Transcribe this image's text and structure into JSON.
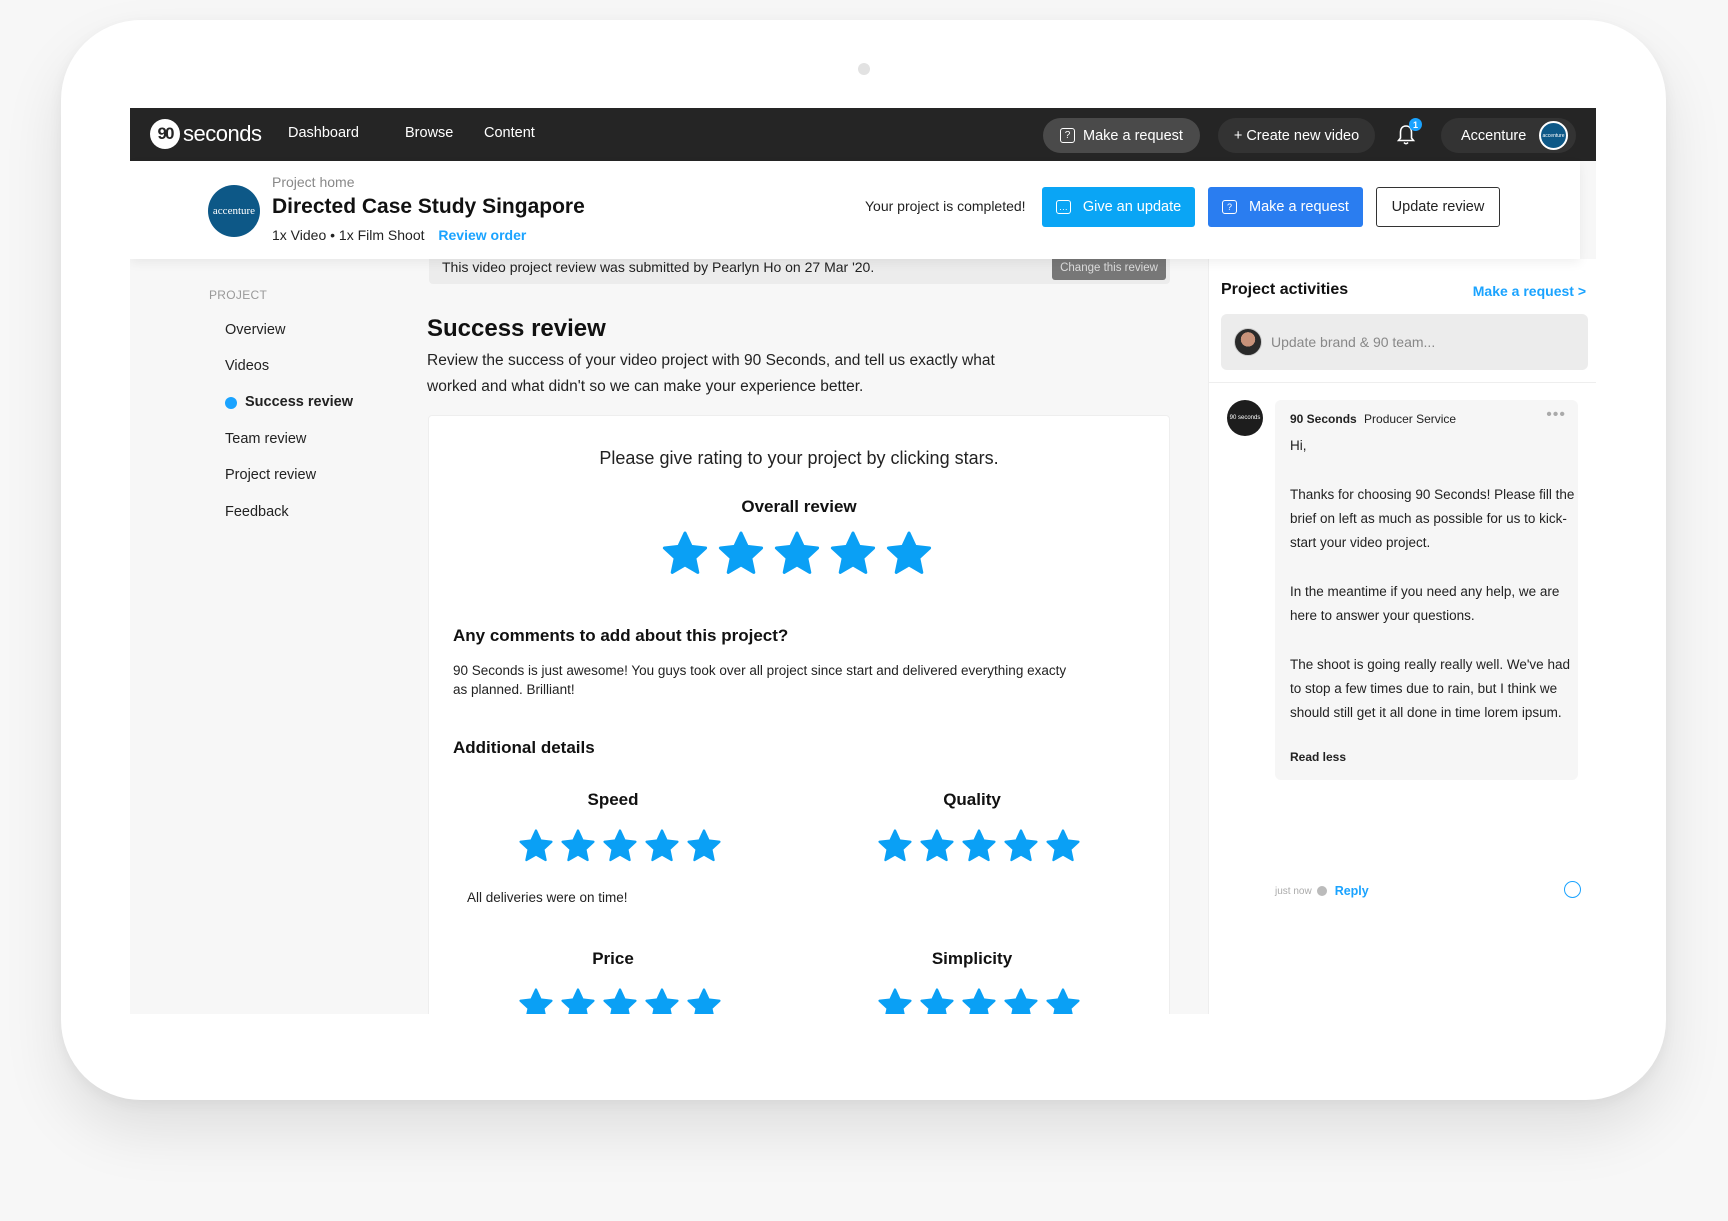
{
  "nav": {
    "logo_mark": "90",
    "logo_text": "seconds",
    "links": [
      "Dashboard",
      "Browse",
      "Content"
    ],
    "make_request": "Make a request",
    "create_video": "+ Create new video",
    "notification_count": "1",
    "account_name": "Accenture",
    "account_avatar_text": "accenture"
  },
  "project": {
    "breadcrumb": "Project home",
    "client_logo_text": "accenture",
    "title": "Directed Case Study Singapore",
    "meta": "1x Video • 1x Film Shoot",
    "review_order": "Review order",
    "status": "Your project is completed!",
    "give_update": "Give an update",
    "make_request": "Make a request",
    "update_review": "Update review"
  },
  "sidebar": {
    "heading": "PROJECT",
    "items": [
      {
        "label": "Overview",
        "active": false
      },
      {
        "label": "Videos",
        "active": false
      },
      {
        "label": "Success review",
        "active": true
      },
      {
        "label": "Team review",
        "active": false
      },
      {
        "label": "Project review",
        "active": false
      },
      {
        "label": "Feedback",
        "active": false
      }
    ]
  },
  "banner": {
    "text": "This video project review was submitted by Pearlyn Ho on 27 Mar '20.",
    "button": "Change this review"
  },
  "main": {
    "title": "Success review",
    "description": "Review the success of your video project with 90 Seconds, and tell us exactly what worked and what didn't so we can make your experience better.",
    "prompt": "Please give rating to your project by clicking stars.",
    "overall_label": "Overall review",
    "overall_rating": 5,
    "overall_max": 5,
    "comments_heading": "Any comments to add about this project?",
    "comment": "90 Seconds is just awesome! You guys took over all project since start and delivered everything exacty as planned. Brilliant!",
    "additional_heading": "Additional details",
    "categories": [
      {
        "label": "Speed",
        "rating": 5,
        "max": 5,
        "note": "All deliveries were on time!"
      },
      {
        "label": "Quality",
        "rating": 5,
        "max": 5,
        "note": ""
      },
      {
        "label": "Price",
        "rating": 5,
        "max": 5,
        "note": ""
      },
      {
        "label": "Simplicity",
        "rating": 5,
        "max": 5,
        "note": ""
      }
    ],
    "star_color": "#0aa0f5"
  },
  "activities": {
    "title": "Project activities",
    "make_request_link": "Make a request >",
    "input_placeholder": "Update brand & 90 team...",
    "message": {
      "sender": "90 Seconds",
      "role": "Producer Service",
      "avatar_text": "90 seconds",
      "paragraphs": [
        "Hi,",
        "Thanks for choosing 90 Seconds! Please fill the brief on left as much as possible for us to kick-start your video project.",
        "In the meantime if you need any help, we are here to answer your questions.",
        "The shoot is going really really well. We've had to stop a few times due to rain, but I think we should still get it all done in time lorem ipsum."
      ],
      "read_less": "Read less",
      "time": "just now",
      "reply": "Reply"
    }
  },
  "colors": {
    "nav_bg": "#252525",
    "accent_blue": "#1aa3ff",
    "button_update": "#0aa5f5",
    "button_request": "#2a7df0",
    "client_blue": "#0d5887"
  }
}
